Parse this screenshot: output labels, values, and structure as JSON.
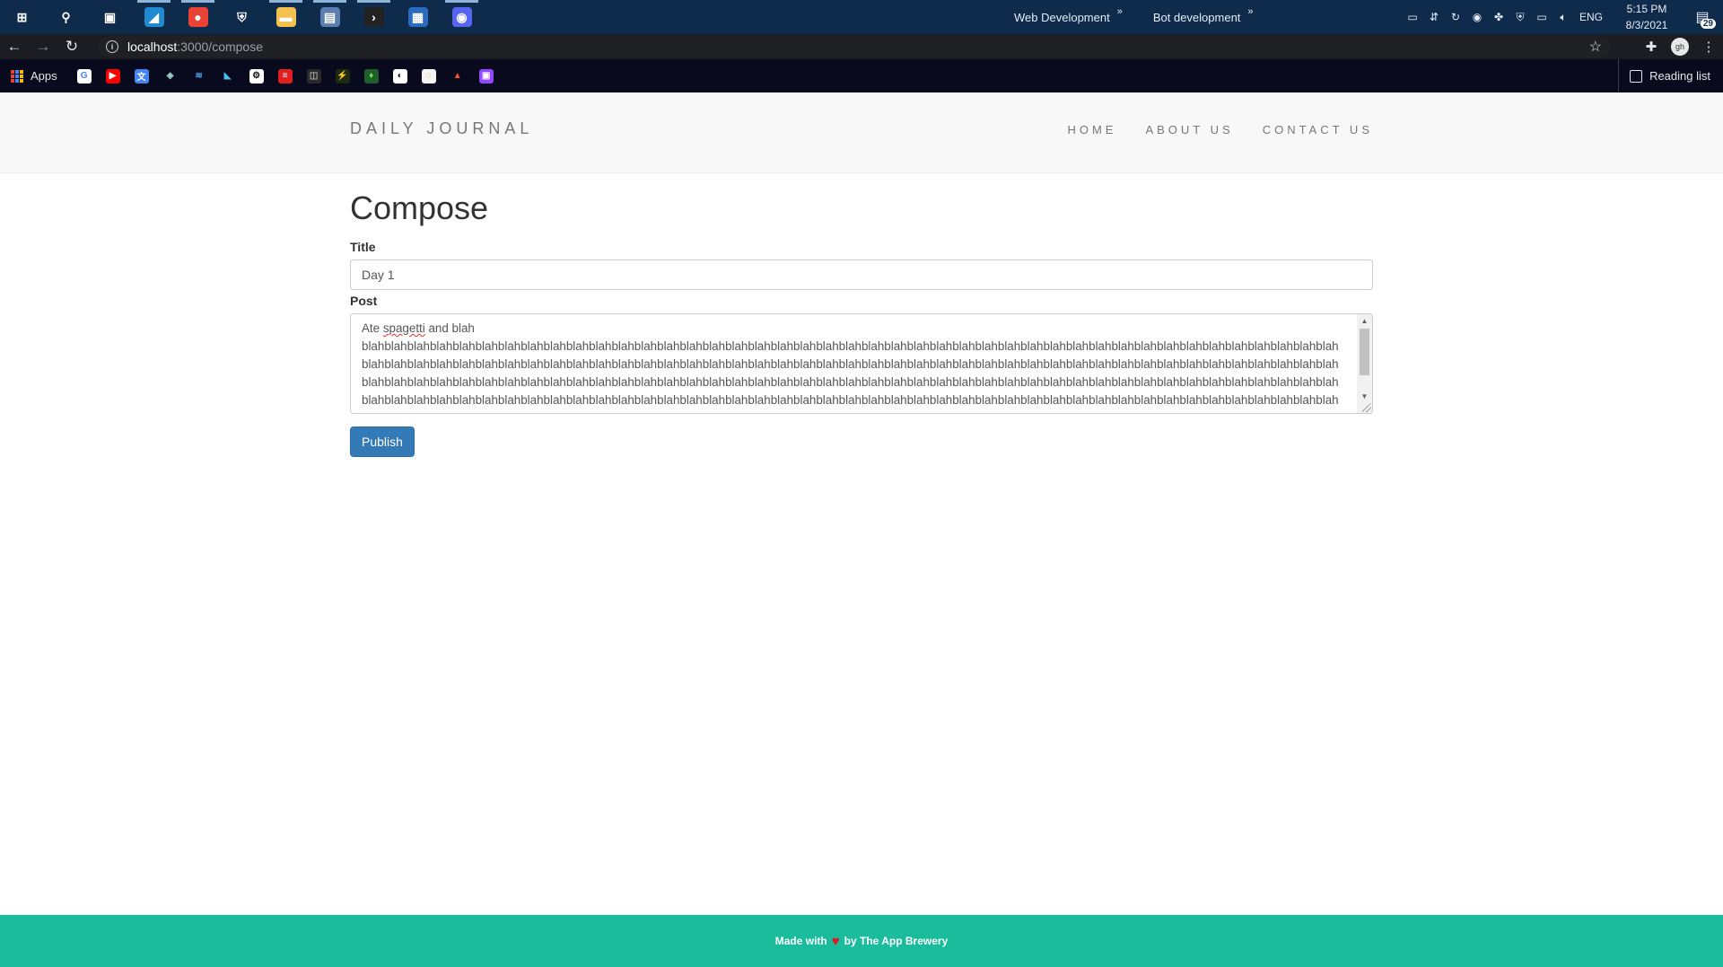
{
  "taskbar": {
    "icons": [
      {
        "name": "windows-start-icon",
        "glyph": "⊞",
        "color": "#0f2b4c"
      },
      {
        "name": "search-icon",
        "glyph": "⚲",
        "color": "#0f2b4c"
      },
      {
        "name": "task-view-icon",
        "glyph": "▣",
        "color": "#0f2b4c"
      },
      {
        "name": "vscode-icon",
        "glyph": "◢",
        "color": "#1f8ad2"
      },
      {
        "name": "chrome-icon",
        "glyph": "●",
        "color": "#e94335"
      },
      {
        "name": "security-shield-icon",
        "glyph": "⛨",
        "color": "#0f2b4c"
      },
      {
        "name": "file-explorer-icon",
        "glyph": "▬",
        "color": "#f2c14e"
      },
      {
        "name": "server-manager-icon",
        "glyph": "▤",
        "color": "#5a7fb0"
      },
      {
        "name": "terminal-icon",
        "glyph": "›",
        "color": "#222222"
      },
      {
        "name": "store-icon",
        "glyph": "▦",
        "color": "#2a6bbf"
      },
      {
        "name": "discord-icon",
        "glyph": "◉",
        "color": "#5865f2"
      }
    ],
    "groups": [
      "Web Development",
      "Bot development"
    ],
    "chevron": "»",
    "tray": {
      "icons": [
        "battery-icon",
        "network-icon",
        "sync-icon",
        "discord-tray-icon",
        "teams-icon",
        "defender-icon",
        "display-icon",
        "volume-icon"
      ],
      "language": "ENG",
      "time": "5:15 PM",
      "date": "8/3/2021",
      "notification_count": "29"
    }
  },
  "browser": {
    "url_host": "localhost",
    "url_path": ":3000/compose",
    "bookmarks_apps_label": "Apps",
    "bookmarks": [
      {
        "name": "google-bookmark-icon",
        "glyph": "G",
        "color": "#ffffff",
        "text": "#4285f4"
      },
      {
        "name": "youtube-bookmark-icon",
        "glyph": "▶",
        "color": "#ff0000",
        "text": "#ffffff"
      },
      {
        "name": "translate-bookmark-icon",
        "glyph": "文",
        "color": "#4285f4",
        "text": "#ffffff"
      },
      {
        "name": "codepen-bookmark-icon",
        "glyph": "◈",
        "color": "#0a0a1e",
        "text": "#9ad1c5"
      },
      {
        "name": "layers-bookmark-icon",
        "glyph": "≋",
        "color": "#0a0a1e",
        "text": "#4aa3f0"
      },
      {
        "name": "flutter-bookmark-icon",
        "glyph": "◣",
        "color": "#0a0a1e",
        "text": "#44c3f2"
      },
      {
        "name": "github-bookmark-icon",
        "glyph": "⚙",
        "color": "#ffffff",
        "text": "#111111"
      },
      {
        "name": "flask-bookmark-icon",
        "glyph": "≡",
        "color": "#e02020",
        "text": "#ffffff"
      },
      {
        "name": "html-bookmark-icon",
        "glyph": "◫",
        "color": "#2a2a2a",
        "text": "#aaaaaa"
      },
      {
        "name": "bolt-bookmark-icon",
        "glyph": "⚡",
        "color": "#1f2a14",
        "text": "#c6e04a"
      },
      {
        "name": "mongodb-bookmark-icon",
        "glyph": "♦",
        "color": "#1e5f2a",
        "text": "#7ed957"
      },
      {
        "name": "globe-bookmark-icon",
        "glyph": "◐",
        "color": "#ffffff",
        "text": "#111111"
      },
      {
        "name": "circle-bookmark-icon",
        "glyph": "◌",
        "color": "#f5f5f5",
        "text": "#f2a900"
      },
      {
        "name": "fire-bookmark-icon",
        "glyph": "▲",
        "color": "#0a0a1e",
        "text": "#ff4f2b"
      },
      {
        "name": "twitch-bookmark-icon",
        "glyph": "▣",
        "color": "#9146ff",
        "text": "#ffffff"
      }
    ],
    "reading_list_label": "Reading list",
    "avatar_initials": "gh"
  },
  "site": {
    "brand": "DAILY JOURNAL",
    "nav": [
      "HOME",
      "ABOUT US",
      "CONTACT US"
    ],
    "page_title": "Compose",
    "title_label": "Title",
    "title_value": "Day 1",
    "post_label": "Post",
    "post_first_word": "Ate",
    "post_misspelled_word": "spagetti",
    "post_first_line_rest": "and blah",
    "post_rest": "blahblahblahblahblahblahblahblahblahblahblahblahblahblahblahblahblahblahblahblahblahblahblahblahblahblahblahblahblahblahblahblahblahblahblahblahblahblahblahblahblahblahblahblahblahblahblahblahblahblahblahblahblahblahblahblahblahblahblahblahblahblahblahblahblahblahblahblahblahblahblahblahblahblahblahblahblahblahblahblahblahblahblahblahblahblahblahblahblahblahblahblahblahblahblahblahblahblahblahblahblahblahblahblahblahblahblahblahblahblahblahblahblahblahblahblahblahblahblahblahblahblahblahblahblahblahblahblahblahblahblahblahblahblahblahblahblahblahblahblahblahblahblahblahblahblahblahblahblahblahblahblahblahblahblahblahblahblahblahblahblahblahblahblahblahblahblahblahblahblahblahblahblahblahblahblahblahblahblahblahblahblahblahblahblahblahblahblahblahblahblahblahblahblahblahblahblahblahblahblahblahblahblahblahblahblahblahblahblahblahblahblahblah",
    "publish_label": "Publish",
    "footer_prefix": "Made with",
    "footer_heart": "♥",
    "footer_suffix": "by The App Brewery"
  },
  "colors": {
    "taskbar": "#0f2b4c",
    "nav_bg": "#f8f8f8",
    "primary_button": "#337ab7",
    "footer_bg": "#1abc9c",
    "heart": "#e0161b"
  }
}
